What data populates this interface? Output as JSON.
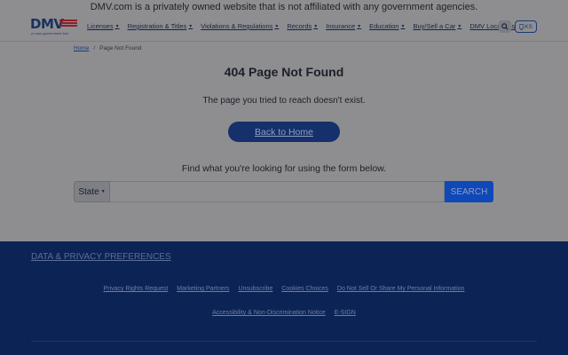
{
  "banner": {
    "text": "DMV.com is a privately owned website that is not affiliated with any government agencies."
  },
  "logo": {
    "text": "DMV",
    "tagline": "a rvars government tool"
  },
  "nav": {
    "items": [
      {
        "label": "Licenses",
        "has_caret": true
      },
      {
        "label": "Registration & Titles",
        "has_caret": true
      },
      {
        "label": "Violations & Regulations",
        "has_caret": true
      },
      {
        "label": "Records",
        "has_caret": true
      },
      {
        "label": "Insurance",
        "has_caret": true
      },
      {
        "label": "Education",
        "has_caret": true
      },
      {
        "label": "Buy/Sell a Car",
        "has_caret": true
      },
      {
        "label": "DMV Locations",
        "has_caret": false
      }
    ],
    "search_icon": "search-icon",
    "location_label": "KS",
    "location_icon": "map-pin-icon"
  },
  "breadcrumb": {
    "home": "Home",
    "separator": "/",
    "current": "Page Not Found"
  },
  "main": {
    "title": "404 Page Not Found",
    "subtitle": "The page you tried to reach doesn't exist.",
    "home_button": "Back to Home",
    "find_text": "Find what you're looking for using the form below.",
    "state_label": "State",
    "search_placeholder": "",
    "search_button": "SEARCH"
  },
  "footer": {
    "privacy_preferences": "DATA & PRIVACY PREFERENCES",
    "links_row1": [
      "Privacy Rights Request",
      "Marketing Partners",
      "Unsubscribe",
      "Cookies Choices",
      "Do Not Sell Or Share My Personal Information"
    ],
    "links_row2": [
      "Accessibility & Non-Discrimination Notice",
      "E-SIGN"
    ]
  },
  "colors": {
    "footer_bg": "#0c2356",
    "button_bg": "#15306a",
    "search_bg": "#0f48b8"
  }
}
